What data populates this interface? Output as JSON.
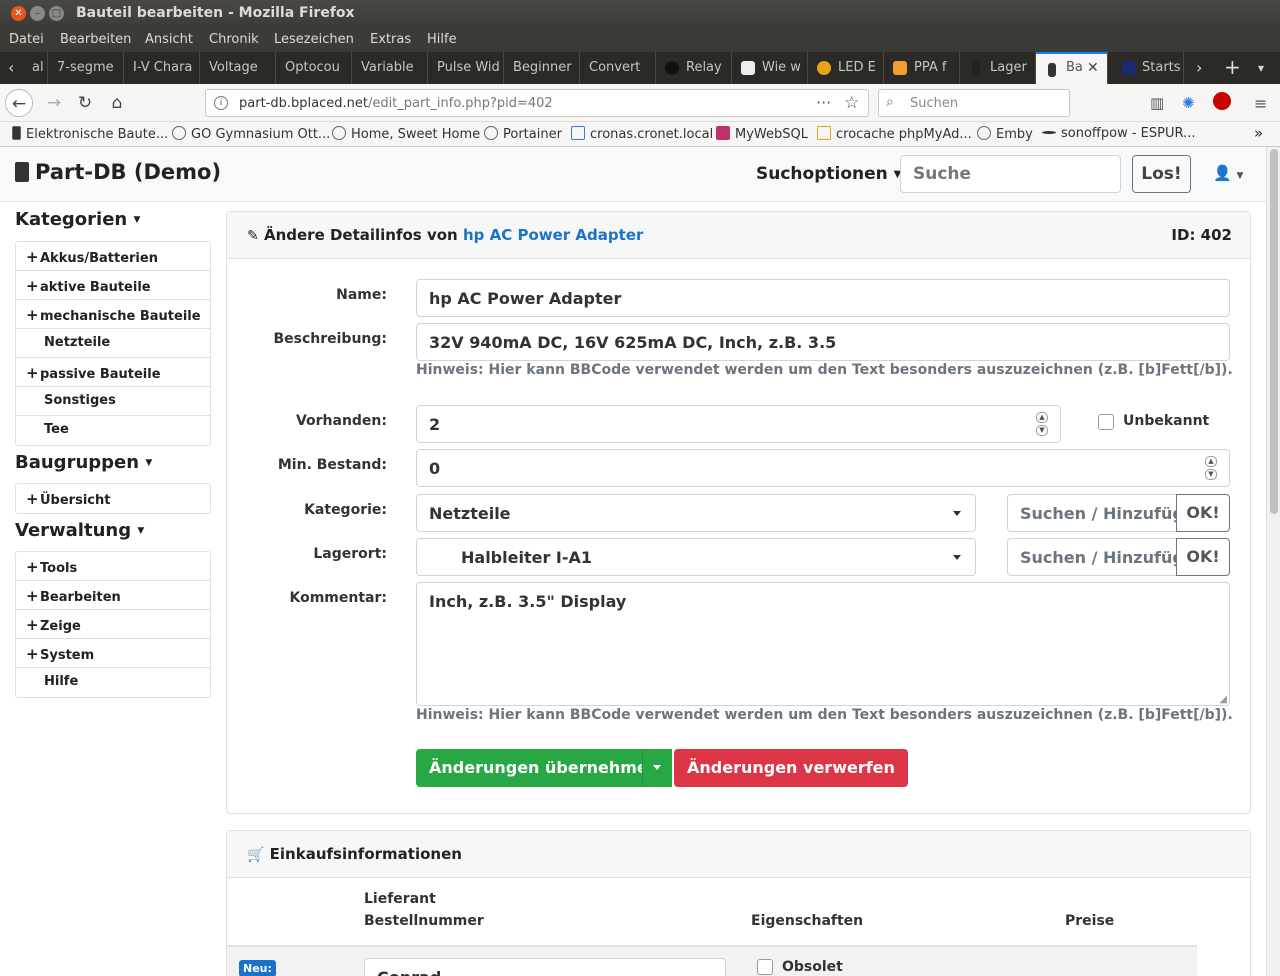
{
  "window": {
    "title": "Bauteil bearbeiten - Mozilla Firefox"
  },
  "menu": [
    "Datei",
    "Bearbeiten",
    "Ansicht",
    "Chronik",
    "Lesezeichen",
    "Extras",
    "Hilfe"
  ],
  "tabs": [
    "al",
    "7-segme",
    "I-V Chara",
    "Voltage",
    "Optocou",
    "Variable",
    "Pulse Wid",
    "Beginner",
    "Convert",
    "Relay",
    "Wie w",
    "LED E",
    "PPA f",
    "Lager",
    "Ba",
    "Starts"
  ],
  "address": {
    "host": "part-db.bplaced.net",
    "path": "/edit_part_info.php?pid=402"
  },
  "browser_search": {
    "placeholder": "Suchen"
  },
  "bookmarks": [
    "Elektronische Baute...",
    "GO Gymnasium Ott...",
    "Home, Sweet Home",
    "Portainer",
    "cronas.cronet.local",
    "MyWebSQL",
    "crocache phpMyAd...",
    "Emby",
    "sonoffpow - ESPUR..."
  ],
  "app": {
    "brand": "Part-DB (Demo)",
    "search_options": "Suchoptionen",
    "search_placeholder": "Suche",
    "search_button": "Los!"
  },
  "sidebar": {
    "kategorien_title": "Kategorien",
    "kategorien": [
      {
        "label": "Akkus/Batterien",
        "expand": true
      },
      {
        "label": "aktive Bauteile",
        "expand": true
      },
      {
        "label": "mechanische Bauteile",
        "expand": true
      },
      {
        "label": "Netzteile",
        "expand": false
      },
      {
        "label": "passive Bauteile",
        "expand": true
      },
      {
        "label": "Sonstiges",
        "expand": false
      },
      {
        "label": "Tee",
        "expand": false
      }
    ],
    "baugruppen_title": "Baugruppen",
    "baugruppen": [
      {
        "label": "Übersicht",
        "expand": true
      }
    ],
    "verwaltung_title": "Verwaltung",
    "verwaltung": [
      {
        "label": "Tools",
        "expand": true
      },
      {
        "label": "Bearbeiten",
        "expand": true
      },
      {
        "label": "Zeige",
        "expand": true
      },
      {
        "label": "System",
        "expand": true
      },
      {
        "label": "Hilfe",
        "expand": false
      }
    ]
  },
  "form": {
    "header_prefix": "Ändere Detailinfos von",
    "header_part": "hp AC Power Adapter",
    "id_label": "ID: 402",
    "name_label": "Name:",
    "name_value": "hp AC Power Adapter",
    "desc_label": "Beschreibung:",
    "desc_value": "32V 940mA DC, 16V 625mA DC, Inch, z.B. 3.5",
    "hint": "Hinweis: Hier kann BBCode verwendet werden um den Text besonders auszuzeichnen (z.B. [b]Fett[/b]).",
    "stock_label": "Vorhanden:",
    "stock_value": "2",
    "unknown_label": "Unbekannt",
    "minstock_label": "Min. Bestand:",
    "minstock_value": "0",
    "category_label": "Kategorie:",
    "category_value": "Netzteile",
    "location_label": "Lagerort:",
    "location_value": "Halbleiter I-A1",
    "search_add_placeholder": "Suchen / Hinzufüg",
    "ok_label": "OK!",
    "comment_label": "Kommentar:",
    "comment_value": "Inch, z.B. 3.5\" Display",
    "apply_button": "Änderungen übernehmen",
    "discard_button": "Änderungen verwerfen"
  },
  "purchase": {
    "title": "Einkaufsinformationen",
    "col_supplier": "Lieferant",
    "col_ordernr": "Bestellnummer",
    "col_props": "Eigenschaften",
    "col_prices": "Preise",
    "new_badge": "Neu:",
    "supplier_value": "Conrad",
    "obsolete_label": "Obsolet"
  }
}
